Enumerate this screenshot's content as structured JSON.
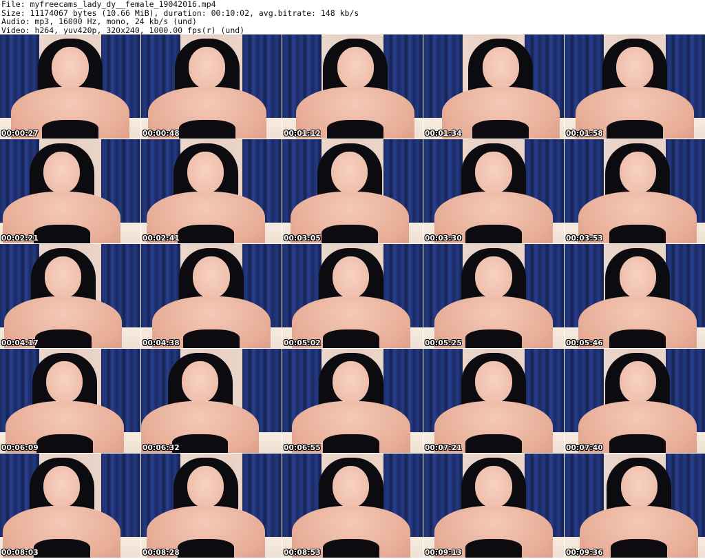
{
  "header": {
    "file_line": "File: myfreecams_lady_dy__female_19042016.mp4",
    "size_line": "Size: 11174067 bytes (10.66 MiB), duration: 00:10:02, avg.bitrate: 148 kb/s",
    "audio_line": "Audio: mp3, 16000 Hz, mono, 24 kb/s (und)",
    "video_line": "Video: h264, yuv420p, 320x240, 1000.00 fps(r) (und)"
  },
  "thumbnails": [
    {
      "timestamp": "00:00:27"
    },
    {
      "timestamp": "00:00:48"
    },
    {
      "timestamp": "00:01:12"
    },
    {
      "timestamp": "00:01:34"
    },
    {
      "timestamp": "00:01:58"
    },
    {
      "timestamp": "00:02:21"
    },
    {
      "timestamp": "00:02:41"
    },
    {
      "timestamp": "00:03:05"
    },
    {
      "timestamp": "00:03:30"
    },
    {
      "timestamp": "00:03:53"
    },
    {
      "timestamp": "00:04:17"
    },
    {
      "timestamp": "00:04:38"
    },
    {
      "timestamp": "00:05:02"
    },
    {
      "timestamp": "00:05:25"
    },
    {
      "timestamp": "00:05:46"
    },
    {
      "timestamp": "00:06:09"
    },
    {
      "timestamp": "00:06:32"
    },
    {
      "timestamp": "00:06:55"
    },
    {
      "timestamp": "00:07:21"
    },
    {
      "timestamp": "00:07:40"
    },
    {
      "timestamp": "00:08:03"
    },
    {
      "timestamp": "00:08:28"
    },
    {
      "timestamp": "00:08:53"
    },
    {
      "timestamp": "00:09:13"
    },
    {
      "timestamp": "00:09:36"
    }
  ]
}
